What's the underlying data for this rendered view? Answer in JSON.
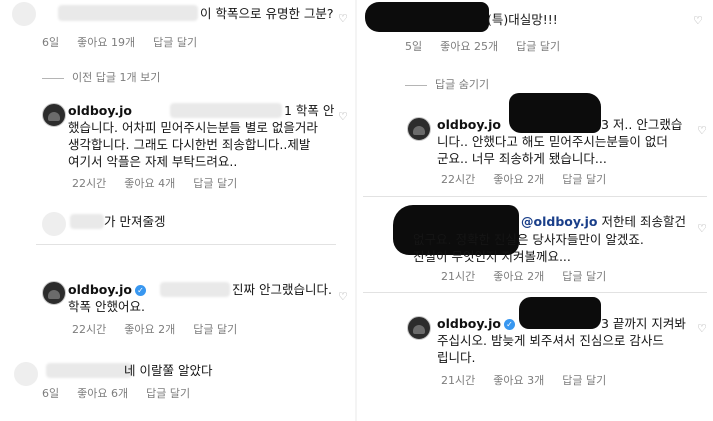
{
  "left": {
    "top_comment": {
      "text": "이 학폭으로 유명한 그분?",
      "age": "6일",
      "likes": "좋아요 19개",
      "reply": "답글 달기"
    },
    "view_replies": "이전 답글 1개 보기",
    "reply1": {
      "username": "oldboy.jo",
      "line1": "1 학폭 안",
      "line2": "했습니다. 어차피 믿어주시는분들 별로 없을거라",
      "line3": "생각합니다.  그래도 다시한번 죄송합니다..제발",
      "line4": "여기서 악플은 자제 부탁드려요..",
      "age": "22시간",
      "likes": "좋아요 4개",
      "reply": "답글 달기"
    },
    "comment2": {
      "text": "가 만져줄겡"
    },
    "reply2": {
      "username": "oldboy.jo",
      "line1": "진짜 안그랬습니다.",
      "line2": "학폭 안했어요.",
      "age": "22시간",
      "likes": "좋아요 2개",
      "reply": "답글 달기"
    },
    "comment3": {
      "text": "네 이랄쭐 알았다",
      "age": "6일",
      "likes": "좋아요 6개",
      "reply": "답글 달기"
    }
  },
  "right": {
    "top_comment": {
      "text": "(특)대실망!!!",
      "age": "5일",
      "likes": "좋아요 25개",
      "reply": "답글 달기"
    },
    "hide_replies": "답글 숨기기",
    "reply1": {
      "username": "oldboy.jo",
      "line1": "3 저.. 안그랬습",
      "line2": "니다.. 안했다고 해도 믿어주시는분들이 없더",
      "line3": "군요.. 너무 죄송하게 됐습니다...",
      "age": "22시간",
      "likes": "좋아요 2개",
      "reply": "답글 달기"
    },
    "comment2": {
      "mention": "@oldboy.jo",
      "line1": "저한테 죄송할건",
      "line2": "없구요. 정확한 진실은 당사자들만이 알겠죠.",
      "line3": "진실이 무엇인지 지켜볼께요...",
      "age": "21시간",
      "likes": "좋아요 2개",
      "reply": "답글 달기"
    },
    "reply2": {
      "username": "oldboy.jo",
      "line1": "3 끝까지 지켜봐",
      "line2": "주십시오. 밤늦게  뵈주셔서 진심으로 감사드",
      "line3": "립니다.",
      "age": "21시간",
      "likes": "좋아요 3개",
      "reply": "답글 달기"
    }
  },
  "icons": {
    "heart": "heart-icon",
    "verified": "verified-badge-icon"
  },
  "colors": {
    "verified": "#3897f0",
    "meta_text": "#7d7d7d",
    "redaction": "#0c0c0c"
  }
}
